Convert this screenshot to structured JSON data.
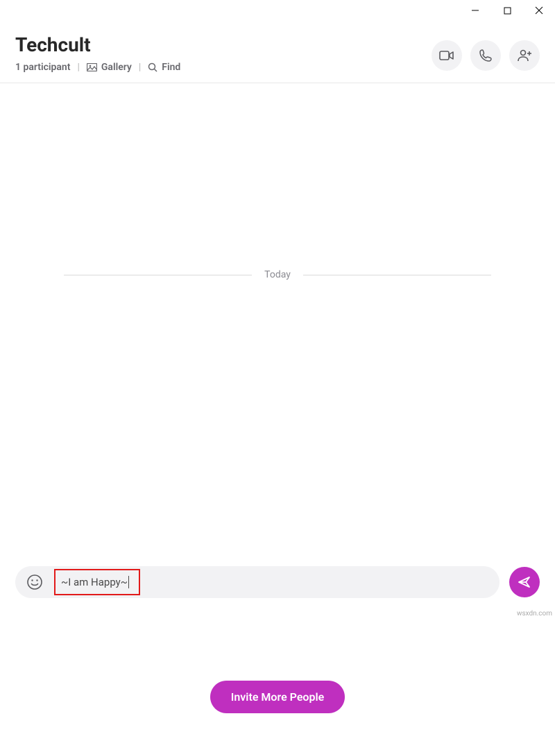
{
  "window": {
    "minimize": "−",
    "maximize": "□",
    "close": "✕"
  },
  "header": {
    "title": "Techcult",
    "participants": "1 participant",
    "gallery": "Gallery",
    "find": "Find"
  },
  "chat": {
    "date_label": "Today",
    "invite_label": "Invite More People"
  },
  "compose": {
    "value": "~I am Happy~"
  },
  "watermark": "wsxdn.com",
  "colors": {
    "accent": "#bf2fbf",
    "highlight": "#e21a1a"
  }
}
